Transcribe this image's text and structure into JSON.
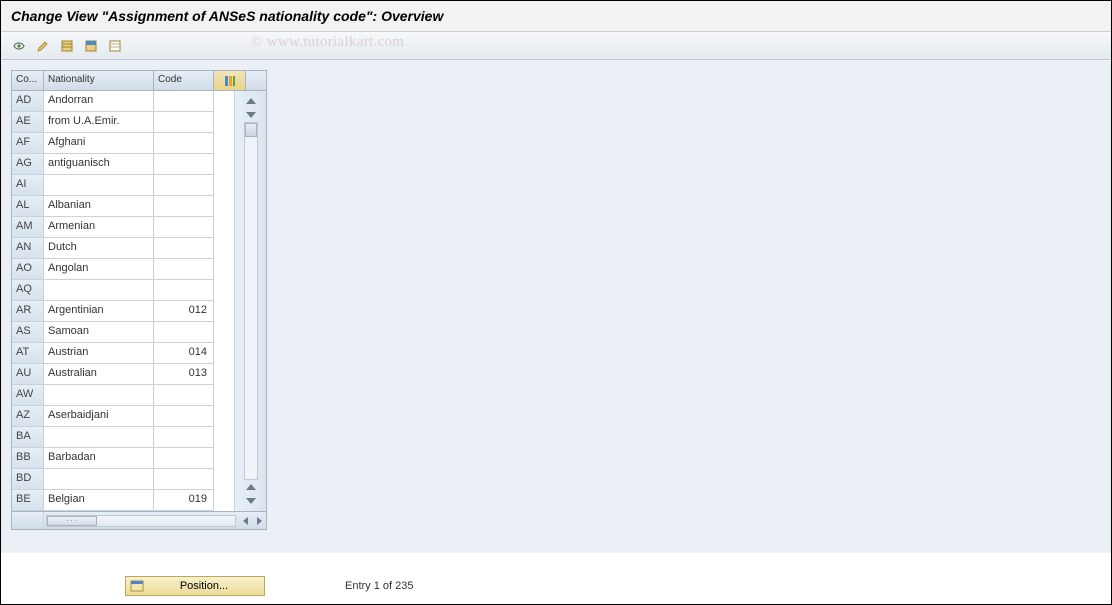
{
  "title": "Change View \"Assignment of ANSeS nationality code\": Overview",
  "watermark": "© www.tutorialkart.com",
  "toolbar": {
    "icons": [
      "other-view-icon",
      "change-icon",
      "select-all-icon",
      "select-block-icon",
      "deselect-all-icon"
    ]
  },
  "grid": {
    "columns": {
      "co": "Co...",
      "nat": "Nationality",
      "code": "Code"
    },
    "config_icon": "table-settings-icon",
    "rows": [
      {
        "co": "AD",
        "nat": "Andorran",
        "code": ""
      },
      {
        "co": "AE",
        "nat": "from U.A.Emir.",
        "code": ""
      },
      {
        "co": "AF",
        "nat": "Afghani",
        "code": ""
      },
      {
        "co": "AG",
        "nat": "antiguanisch",
        "code": ""
      },
      {
        "co": "AI",
        "nat": "",
        "code": ""
      },
      {
        "co": "AL",
        "nat": "Albanian",
        "code": ""
      },
      {
        "co": "AM",
        "nat": "Armenian",
        "code": ""
      },
      {
        "co": "AN",
        "nat": "Dutch",
        "code": ""
      },
      {
        "co": "AO",
        "nat": "Angolan",
        "code": ""
      },
      {
        "co": "AQ",
        "nat": "",
        "code": ""
      },
      {
        "co": "AR",
        "nat": "Argentinian",
        "code": "012"
      },
      {
        "co": "AS",
        "nat": "Samoan",
        "code": ""
      },
      {
        "co": "AT",
        "nat": "Austrian",
        "code": "014"
      },
      {
        "co": "AU",
        "nat": "Australian",
        "code": "013"
      },
      {
        "co": "AW",
        "nat": "",
        "code": ""
      },
      {
        "co": "AZ",
        "nat": "Aserbaidjani",
        "code": ""
      },
      {
        "co": "BA",
        "nat": "",
        "code": ""
      },
      {
        "co": "BB",
        "nat": "Barbadan",
        "code": ""
      },
      {
        "co": "BD",
        "nat": "",
        "code": ""
      },
      {
        "co": "BE",
        "nat": "Belgian",
        "code": "019"
      }
    ]
  },
  "footer": {
    "position_label": "Position...",
    "entry_text": "Entry 1 of 235"
  }
}
